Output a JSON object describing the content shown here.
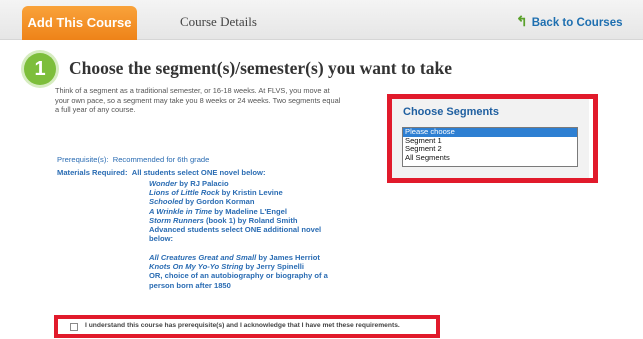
{
  "tabs": {
    "active_label": "Add This Course",
    "inactive_label": "Course Details"
  },
  "back_link": {
    "label": "Back to Courses",
    "icon": "curved-arrow-left-icon"
  },
  "step": {
    "number": "1",
    "heading": "Choose the segment(s)/semester(s) you want to take"
  },
  "intro": [
    "Think of a segment as a traditional semester, or 16-18 weeks. At FLVS, you move at",
    "your own pace, so a segment may take you 8 weeks or 24 weeks. Two segments equal",
    "a full year of any course."
  ],
  "prerequisite": {
    "label": "Prerequisite(s):",
    "value": "Recommended for 6th grade"
  },
  "materials": {
    "label": "Materials Required:",
    "value": "All students select ONE novel below:"
  },
  "books": [
    {
      "title": "Wonder",
      "rest": " by RJ Palacio"
    },
    {
      "title": "Lions of Little Rock",
      "rest": " by Kristin Levine"
    },
    {
      "title": "Schooled",
      "rest": " by Gordon Korman"
    },
    {
      "title": "A Wrinkle in Time",
      "rest": " by Madeline L'Engel"
    },
    {
      "title": "Storm Runners",
      "rest": " (book 1) by Roland Smith"
    }
  ],
  "advanced_note": [
    "Advanced students select ONE additional novel",
    "below:"
  ],
  "advanced_books": [
    {
      "title": "All Creatures Great and Small",
      "rest": " by James Herriot"
    },
    {
      "title": "Knots On My Yo-Yo String",
      "rest": " by Jerry Spinelli"
    }
  ],
  "advanced_other": [
    "OR, choice of an autobiography or biography of a",
    "person born after 1850"
  ],
  "segments": {
    "title": "Choose Segments",
    "options": [
      "Please choose",
      "Segment 1",
      "Segment 2",
      "All Segments"
    ],
    "selected": "Please choose"
  },
  "acknowledge": {
    "label": "I understand this course has prerequisite(s) and I acknowledge that I have met these requirements.",
    "checked": false
  },
  "colors": {
    "accent": "#ee8319",
    "link": "#2a6cb3",
    "highlight": "#e11a2b",
    "step": "#7dbe3b"
  }
}
